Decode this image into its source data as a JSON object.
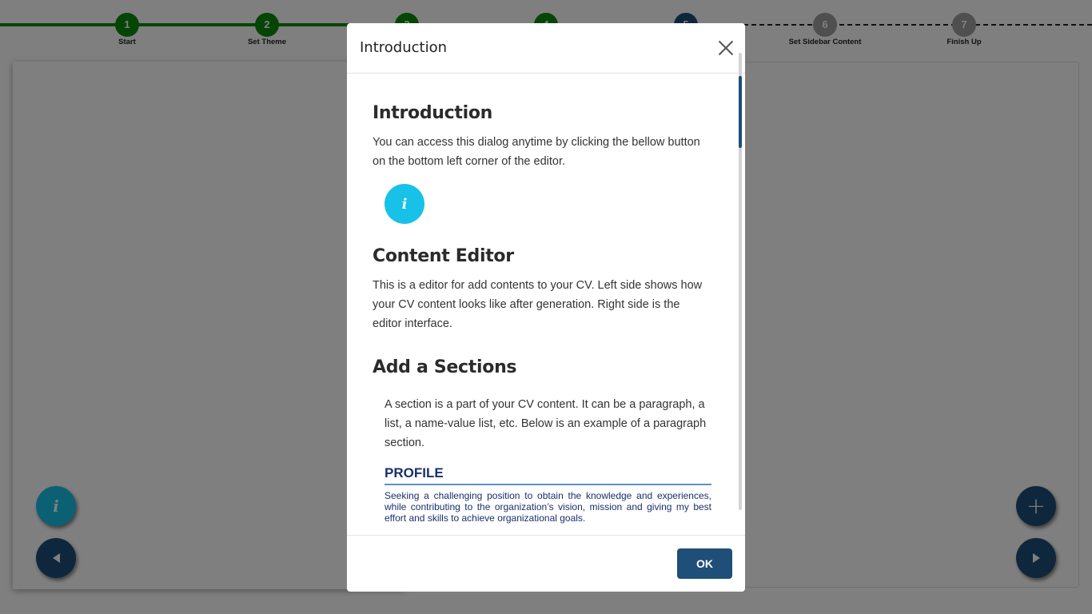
{
  "stepper": {
    "steps": [
      {
        "number": "1",
        "label": "Start",
        "state": "done"
      },
      {
        "number": "2",
        "label": "Set Theme",
        "state": "done"
      },
      {
        "number": "3",
        "label": "",
        "state": "done"
      },
      {
        "number": "4",
        "label": "",
        "state": "done"
      },
      {
        "number": "5",
        "label": "",
        "state": "current"
      },
      {
        "number": "6",
        "label": "Set Sidebar Content",
        "state": "todo"
      },
      {
        "number": "7",
        "label": "Finish Up",
        "state": "todo"
      }
    ],
    "colors": {
      "done": "#0b8a0b",
      "current": "#1f4e79",
      "todo": "#9e9e9e"
    }
  },
  "fabs": {
    "info_glyph": "i",
    "info_icon": "info-icon",
    "prev_icon": "arrow-left-icon",
    "add_icon": "plus-icon",
    "add_glyph": "+",
    "next_icon": "arrow-right-icon"
  },
  "modal": {
    "title": "Introduction",
    "close_icon": "close-icon",
    "sections": {
      "intro": {
        "heading": "Introduction",
        "text": "You can access this dialog anytime by clicking the bellow button on the bottom left corner of the editor.",
        "demo_glyph": "i"
      },
      "editor": {
        "heading": "Content Editor",
        "text": "This is a editor for add contents to your CV. Left side shows how your CV content looks like after generation. Right side is the editor interface."
      },
      "add": {
        "heading": "Add a Sections",
        "text": "A section is a part of your CV content. It can be a paragraph, a list, a name-value list, etc. Below is an example of a paragraph section.",
        "example_title": "PROFILE",
        "example_text": "Seeking a challenging position to obtain the knowledge and experiences, while contributing to the organization’s vision, mission and giving my best effort and skills to achieve organizational goals."
      }
    },
    "ok_label": "OK",
    "accent": "#1f4e79",
    "info_color": "#17c1e8"
  }
}
